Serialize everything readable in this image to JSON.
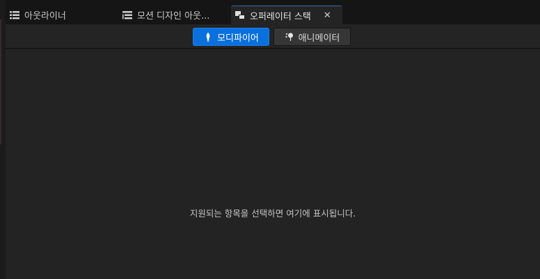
{
  "tabs": [
    {
      "label": "아웃라이너",
      "icon": "outliner-icon",
      "active": false
    },
    {
      "label": "모션 디자인 아웃...",
      "icon": "outliner-icon",
      "active": false
    },
    {
      "label": "오퍼레이터 스택",
      "icon": "operator-stack-icon",
      "active": true,
      "close": "✕"
    }
  ],
  "toolbar": {
    "modifier_label": "모디파이어",
    "animator_label": "애니메이터",
    "active_mode": "modifier"
  },
  "content": {
    "empty_message": "지원되는 항목을 선택하면 여기에 표시됩니다."
  },
  "colors": {
    "accent": "#0a70de",
    "panel": "#242424",
    "background": "#151515"
  }
}
